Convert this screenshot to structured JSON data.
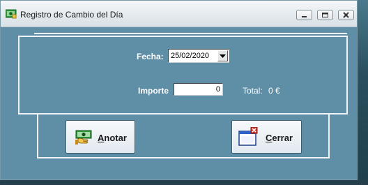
{
  "window": {
    "title": "Registro de Cambio del Día"
  },
  "form": {
    "fecha_label": "Fecha:",
    "fecha_value": "25/02/2020",
    "importe_label": "Importe",
    "importe_value": "0",
    "total_label": "Total:",
    "total_value": "0 €"
  },
  "buttons": {
    "anotar": {
      "mnemonic": "A",
      "rest": "notar"
    },
    "cerrar": {
      "mnemonic": "C",
      "rest": "errar"
    }
  },
  "icons": {
    "app": "money-icon",
    "anotar": "money-hand-icon",
    "cerrar": "close-window-icon",
    "dropdown": "chevron-down-icon"
  },
  "colors": {
    "window_bg": "#5e8fa6",
    "titlebar": "#e6ecf0",
    "label_text": "#ffffff"
  }
}
